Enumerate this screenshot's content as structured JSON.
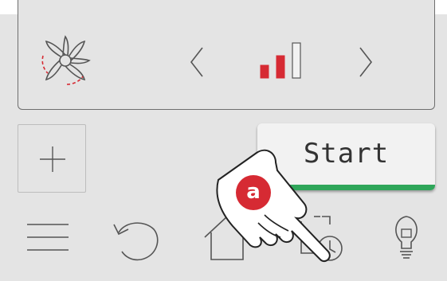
{
  "fan": {
    "icon": "fan-icon",
    "prev_icon": "chevron-left-icon",
    "next_icon": "chevron-right-icon",
    "level_icon": "fan-level-icon",
    "level_active": 2,
    "level_total": 3
  },
  "add_icon": "plus-icon",
  "start_button": {
    "label": "Start"
  },
  "bottom_bar": [
    {
      "name": "menu",
      "icon": "menu-icon"
    },
    {
      "name": "undo",
      "icon": "undo-icon"
    },
    {
      "name": "home",
      "icon": "home-icon"
    },
    {
      "name": "timer",
      "icon": "timer-icon"
    },
    {
      "name": "light",
      "icon": "lightbulb-icon"
    }
  ],
  "annotation": {
    "badge_label": "a",
    "icon": "hand-pointer-icon"
  },
  "colors": {
    "accent_red": "#d62a33",
    "start_green": "#2fa65a",
    "line_gray": "#555555"
  }
}
